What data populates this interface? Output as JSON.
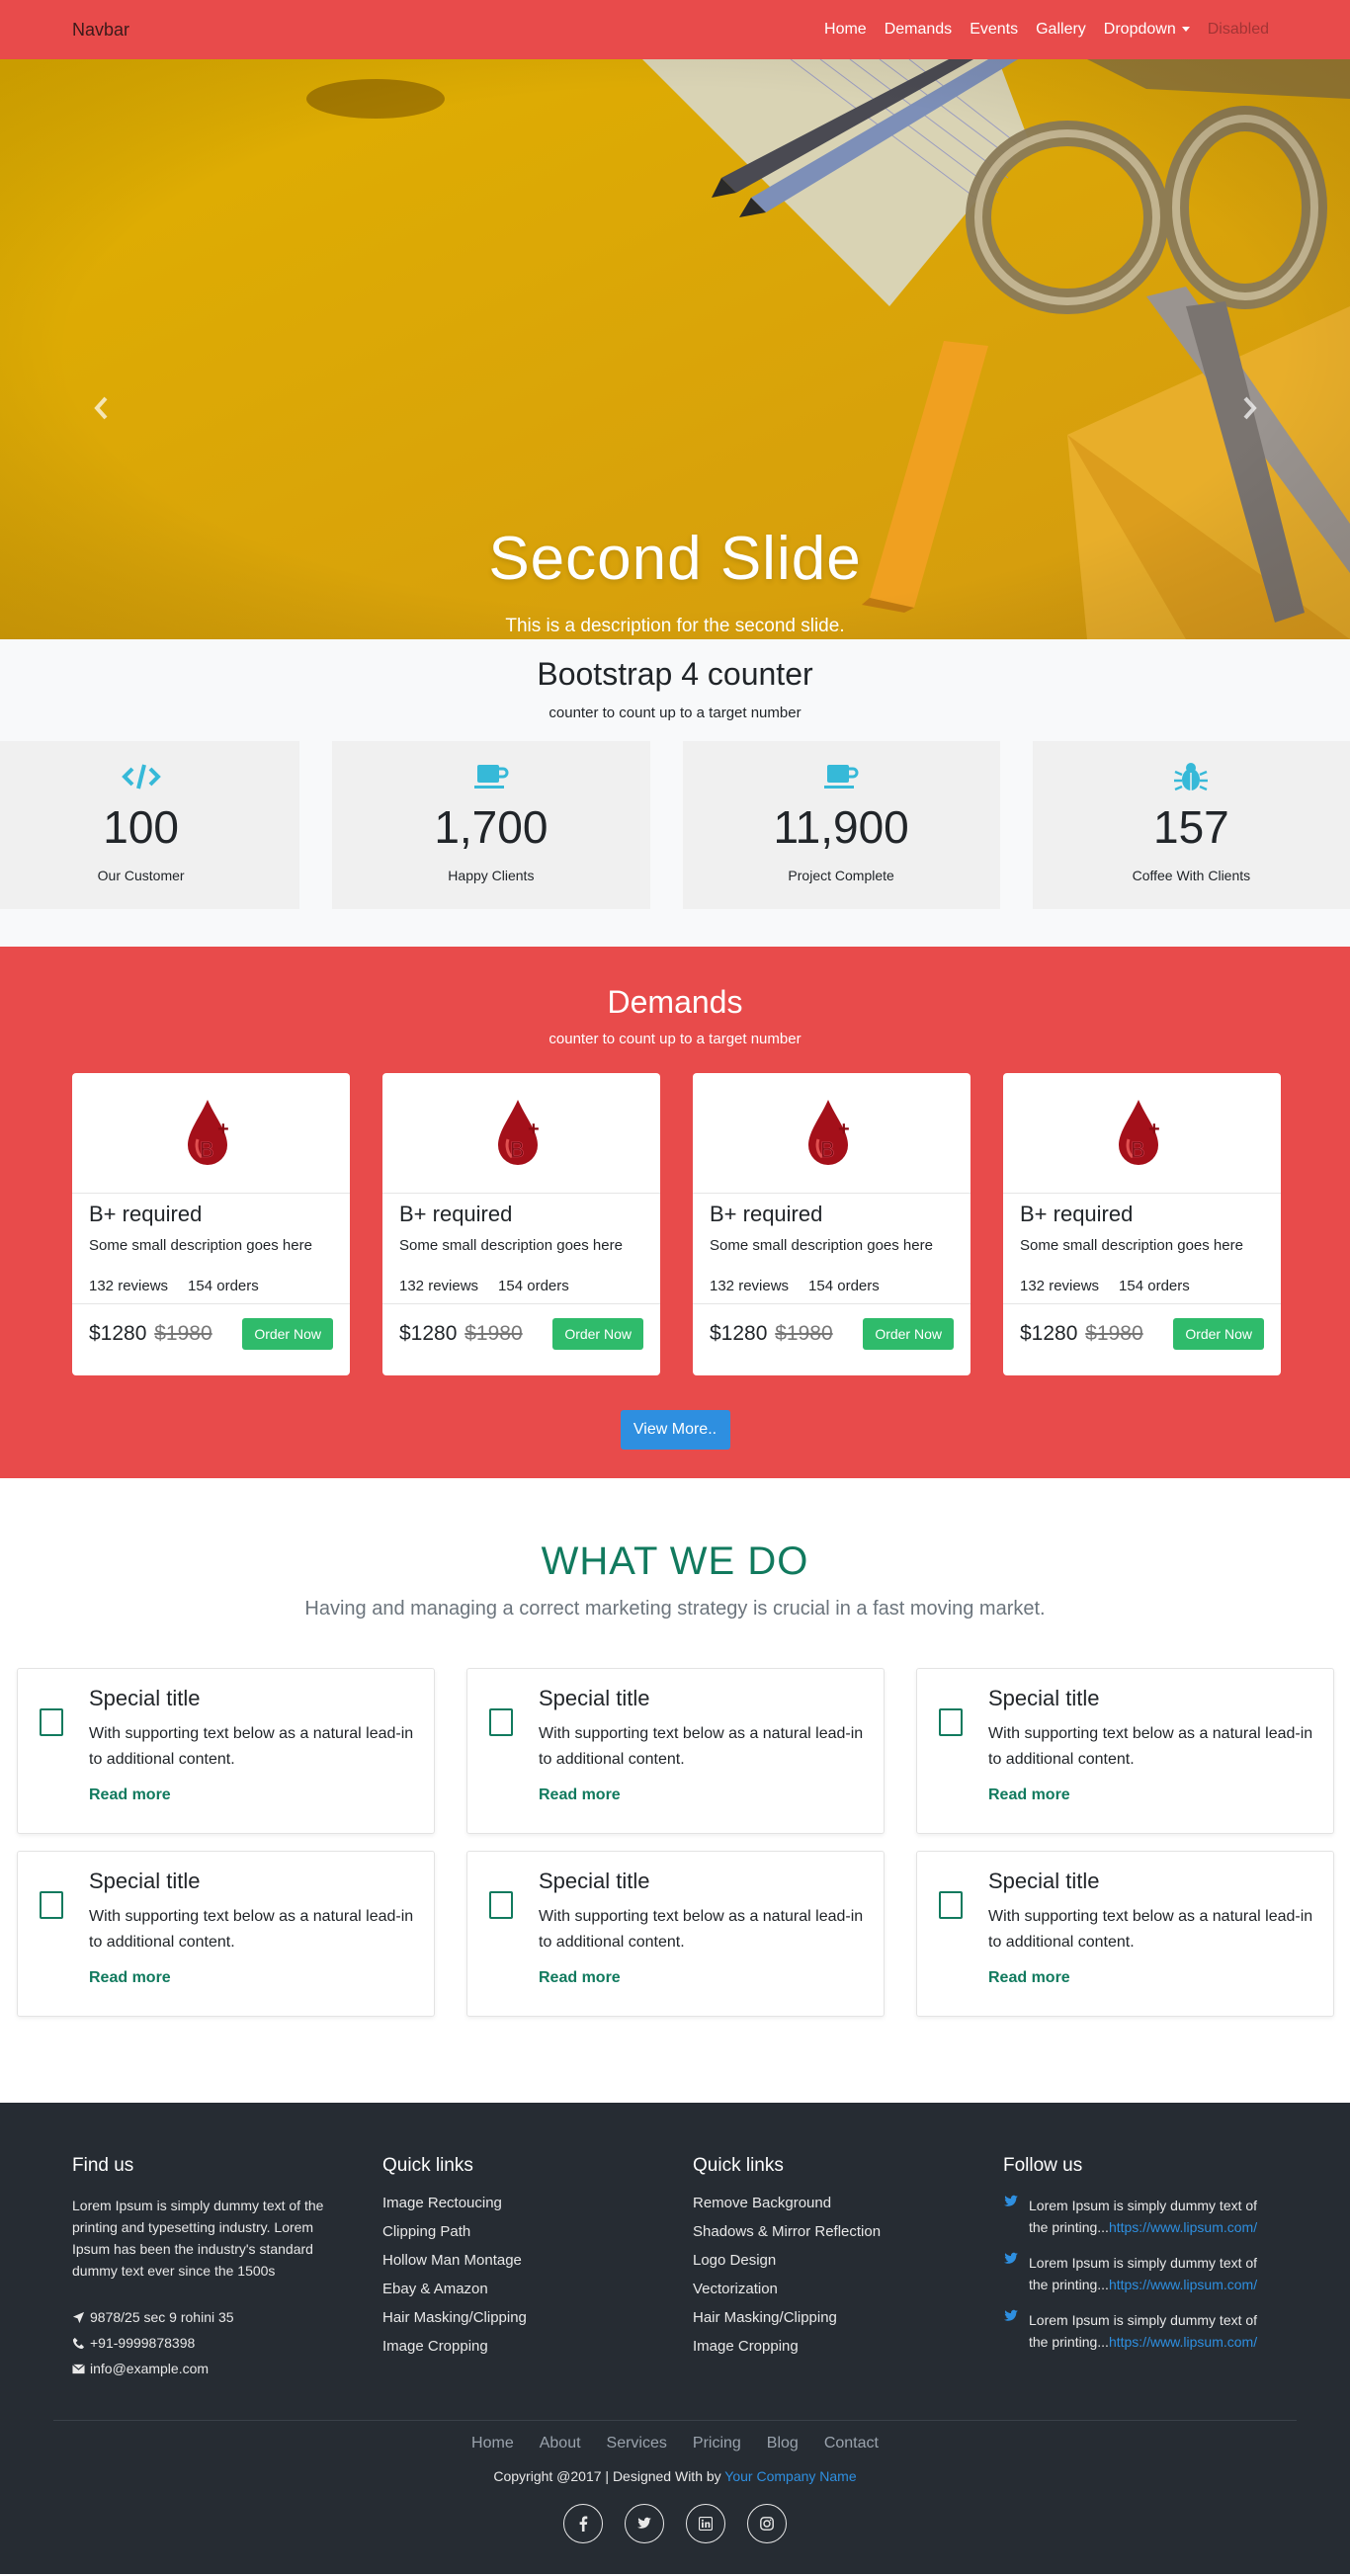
{
  "navbar": {
    "brand": "Navbar",
    "links": [
      "Home",
      "Demands",
      "Events",
      "Gallery",
      "Dropdown",
      "Disabled"
    ]
  },
  "hero": {
    "title": "Second Slide",
    "description": "This is a description for the second slide.",
    "slide_count": 3,
    "active_slide": 2
  },
  "counter": {
    "title": "Bootstrap 4 counter",
    "subtitle": "counter to count up to a target number",
    "items": [
      {
        "icon": "code-icon",
        "value": "100",
        "label": "Our Customer"
      },
      {
        "icon": "coffee-icon",
        "value": "1,700",
        "label": "Happy Clients"
      },
      {
        "icon": "coffee-icon",
        "value": "11,900",
        "label": "Project Complete"
      },
      {
        "icon": "bug-icon",
        "value": "157",
        "label": "Coffee With Clients"
      }
    ]
  },
  "demands": {
    "title": "Demands",
    "subtitle": "counter to count up to a target number",
    "cards": [
      {
        "title": "B+ required",
        "description": "Some small description goes here",
        "reviews": "132 reviews",
        "orders": "154 orders",
        "price": "$1280",
        "old_price": "$1980",
        "button": "Order Now"
      },
      {
        "title": "B+ required",
        "description": "Some small description goes here",
        "reviews": "132 reviews",
        "orders": "154 orders",
        "price": "$1280",
        "old_price": "$1980",
        "button": "Order Now"
      },
      {
        "title": "B+ required",
        "description": "Some small description goes here",
        "reviews": "132 reviews",
        "orders": "154 orders",
        "price": "$1280",
        "old_price": "$1980",
        "button": "Order Now"
      },
      {
        "title": "B+ required",
        "description": "Some small description goes here",
        "reviews": "132 reviews",
        "orders": "154 orders",
        "price": "$1280",
        "old_price": "$1980",
        "button": "Order Now"
      }
    ],
    "view_more": "View More.."
  },
  "what_we_do": {
    "title": "WHAT WE DO",
    "subtitle": "Having and managing a correct marketing strategy is crucial in a fast moving market.",
    "cards": [
      {
        "title": "Special title",
        "text": "With supporting text below as a natural lead-in to additional content.",
        "link": "Read more"
      },
      {
        "title": "Special title",
        "text": "With supporting text below as a natural lead-in to additional content.",
        "link": "Read more"
      },
      {
        "title": "Special title",
        "text": "With supporting text below as a natural lead-in to additional content.",
        "link": "Read more"
      },
      {
        "title": "Special title",
        "text": "With supporting text below as a natural lead-in to additional content.",
        "link": "Read more"
      },
      {
        "title": "Special title",
        "text": "With supporting text below as a natural lead-in to additional content.",
        "link": "Read more"
      },
      {
        "title": "Special title",
        "text": "With supporting text below as a natural lead-in to additional content.",
        "link": "Read more"
      }
    ]
  },
  "footer": {
    "find_us": {
      "title": "Find us",
      "text": "Lorem Ipsum is simply dummy text of the printing and typesetting industry. Lorem Ipsum has been the industry's standard dummy text ever since the 1500s",
      "address": "9878/25 sec 9 rohini 35",
      "phone": "+91-9999878398",
      "email": "info@example.com"
    },
    "quick_links_1": {
      "title": "Quick links",
      "items": [
        "Image Rectoucing",
        "Clipping Path",
        "Hollow Man Montage",
        "Ebay & Amazon",
        "Hair Masking/Clipping",
        "Image Cropping"
      ]
    },
    "quick_links_2": {
      "title": "Quick links",
      "items": [
        "Remove Background",
        "Shadows & Mirror Reflection",
        "Logo Design",
        "Vectorization",
        "Hair Masking/Clipping",
        "Image Cropping"
      ]
    },
    "follow_us": {
      "title": "Follow us",
      "tweets": [
        {
          "text": "Lorem Ipsum is simply dummy text of the printing...",
          "link": "https://www.lipsum.com/"
        },
        {
          "text": "Lorem Ipsum is simply dummy text of the printing...",
          "link": "https://www.lipsum.com/"
        },
        {
          "text": "Lorem Ipsum is simply dummy text of the printing...",
          "link": "https://www.lipsum.com/"
        }
      ]
    },
    "nav": [
      "Home",
      "About",
      "Services",
      "Pricing",
      "Blog",
      "Contact"
    ],
    "copyright_prefix": "Copyright @2017 | Designed With by ",
    "company": "Your Company Name",
    "socials": [
      "facebook-icon",
      "twitter-icon",
      "linkedin-icon",
      "instagram-icon"
    ]
  },
  "colors": {
    "primary_red": "#e84b4b",
    "green": "#117a5e",
    "button_green": "#2fbb6b",
    "button_blue": "#2e8fe0",
    "footer_bg": "#262c33"
  }
}
